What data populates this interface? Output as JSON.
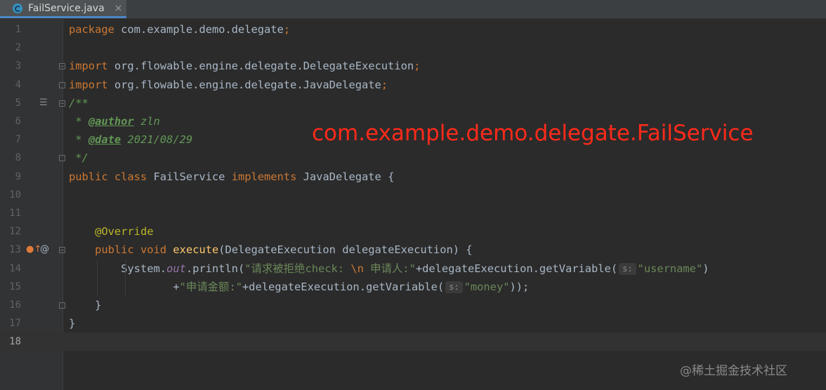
{
  "tab": {
    "label": "FailService.java",
    "close": "×",
    "icon": "java-class-icon"
  },
  "lines": [
    {
      "n": "1",
      "tokens": [
        [
          "kw",
          "package "
        ],
        [
          "id",
          "com.example.demo.delegate"
        ],
        [
          "kw",
          ";"
        ]
      ]
    },
    {
      "n": "2",
      "tokens": []
    },
    {
      "n": "3",
      "tokens": [
        [
          "kw",
          "import "
        ],
        [
          "id",
          "org.flowable.engine.delegate.DelegateExecution"
        ],
        [
          "kw",
          ";"
        ]
      ]
    },
    {
      "n": "4",
      "tokens": [
        [
          "kw",
          "import "
        ],
        [
          "id",
          "org.flowable.engine.delegate.JavaDelegate"
        ],
        [
          "kw",
          ";"
        ]
      ]
    },
    {
      "n": "5",
      "tokens": [
        [
          "cmt",
          "/**"
        ]
      ]
    },
    {
      "n": "6",
      "tokens": [
        [
          "cmt",
          " * "
        ],
        [
          "tag",
          "@author"
        ],
        [
          "cmt",
          " zln"
        ]
      ]
    },
    {
      "n": "7",
      "tokens": [
        [
          "cmt",
          " * "
        ],
        [
          "tag",
          "@date"
        ],
        [
          "cmt",
          " 2021/08/29"
        ]
      ]
    },
    {
      "n": "8",
      "tokens": [
        [
          "cmt",
          " */"
        ]
      ]
    },
    {
      "n": "9",
      "tokens": [
        [
          "kw",
          "public class "
        ],
        [
          "id",
          "FailService "
        ],
        [
          "kw",
          "implements "
        ],
        [
          "id",
          "JavaDelegate {"
        ]
      ]
    },
    {
      "n": "10",
      "tokens": []
    },
    {
      "n": "11",
      "tokens": []
    },
    {
      "n": "12",
      "tokens": [
        [
          "id",
          "    "
        ],
        [
          "ann",
          "@Override"
        ]
      ]
    },
    {
      "n": "13",
      "tokens": [
        [
          "id",
          "    "
        ],
        [
          "kw",
          "public void "
        ],
        [
          "fn",
          "execute"
        ],
        [
          "id",
          "(DelegateExecution delegateExecution) {"
        ]
      ]
    },
    {
      "n": "14",
      "tokens": [
        [
          "id",
          "        System."
        ],
        [
          "static",
          "out"
        ],
        [
          "id",
          ".println("
        ],
        [
          "str",
          "\"请求被拒绝check: "
        ],
        [
          "esc",
          "\\n"
        ],
        [
          "str",
          " 申请人:\""
        ],
        [
          "id",
          "+delegateExecution.getVariable("
        ],
        [
          "hint",
          "s:"
        ],
        [
          "str",
          "\"username\""
        ],
        [
          "id",
          ")"
        ]
      ]
    },
    {
      "n": "15",
      "tokens": [
        [
          "id",
          "                +"
        ],
        [
          "str",
          "\"申请金额:\""
        ],
        [
          "id",
          "+delegateExecution.getVariable("
        ],
        [
          "hint",
          "s:"
        ],
        [
          "str",
          "\"money\""
        ],
        [
          "id",
          "));"
        ]
      ]
    },
    {
      "n": "16",
      "tokens": [
        [
          "id",
          "    }"
        ]
      ]
    },
    {
      "n": "17",
      "tokens": [
        [
          "id",
          "}"
        ]
      ]
    },
    {
      "n": "18",
      "tokens": []
    }
  ],
  "overlay_text": "com.example.demo.delegate.FailService",
  "watermark": "@稀土掘金技术社区",
  "gutter_icons": {
    "line5": "javadoc-icon",
    "line13_a": "implements-method-icon",
    "line13_b": "override-annotation-icon",
    "line13_a_glyph": "●↑",
    "line13_b_glyph": "@"
  },
  "current_line": "18"
}
